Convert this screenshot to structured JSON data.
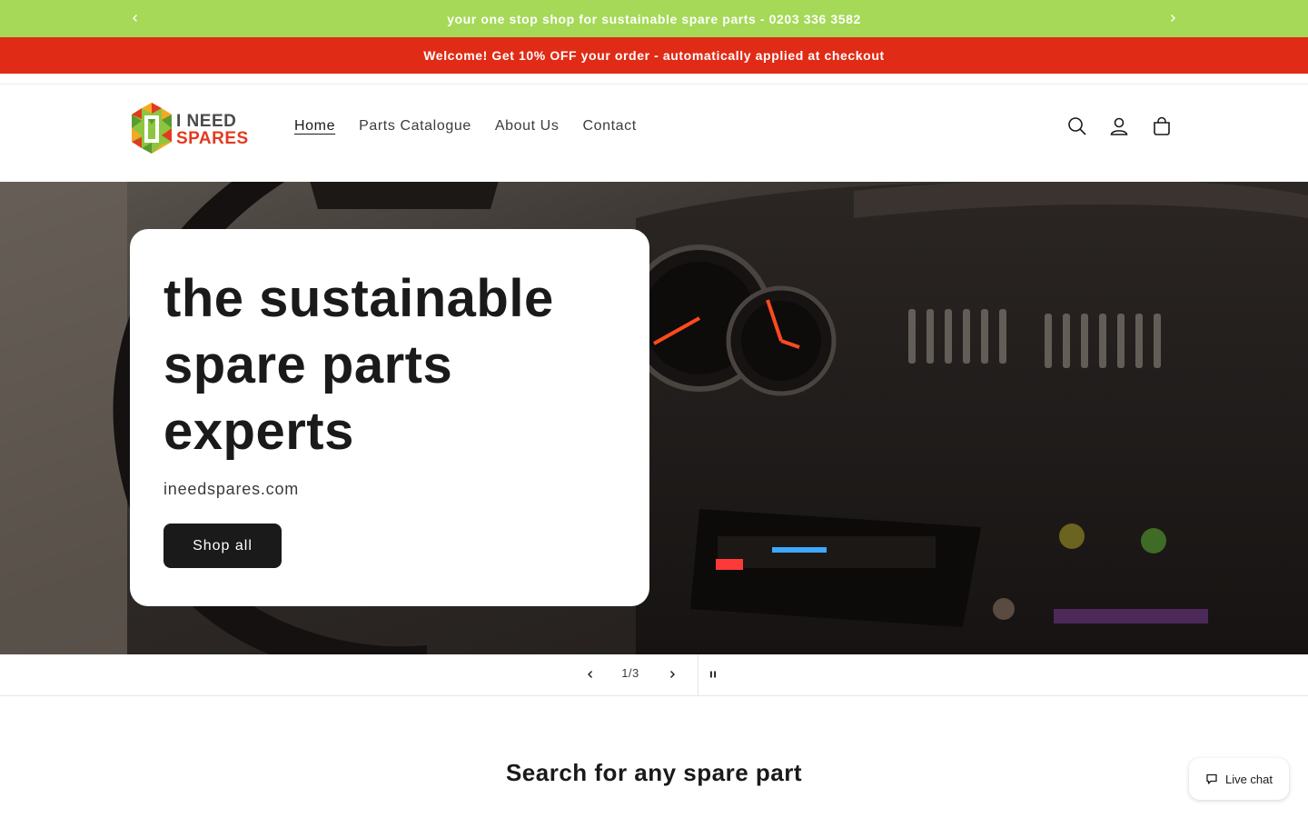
{
  "announcement": {
    "message": "your one stop shop for sustainable spare parts - 0203 336 3582",
    "prev_icon": "chevron-left-icon",
    "next_icon": "chevron-right-icon",
    "background": "#a5d957"
  },
  "promo": {
    "message": "Welcome! Get 10% OFF your order - automatically applied at checkout",
    "background": "#e02b16"
  },
  "header": {
    "logo": {
      "line1": "I NEED",
      "line2": "SPARES"
    },
    "nav": [
      {
        "label": "Home",
        "active": true
      },
      {
        "label": "Parts Catalogue",
        "active": false
      },
      {
        "label": "About Us",
        "active": false
      },
      {
        "label": "Contact",
        "active": false
      }
    ],
    "icons": [
      "search-icon",
      "account-icon",
      "cart-icon"
    ]
  },
  "hero": {
    "title": "the sustainable spare parts experts",
    "subtitle": "ineedspares.com",
    "button_label": "Shop all"
  },
  "slider": {
    "counter": "1/3",
    "current": 1,
    "total": 3,
    "icons": [
      "chevron-left-icon",
      "chevron-right-icon",
      "pause-icon"
    ]
  },
  "section": {
    "title": "Search for any spare part"
  },
  "live_chat": {
    "label": "Live chat",
    "icon": "chat-bubble-icon"
  }
}
